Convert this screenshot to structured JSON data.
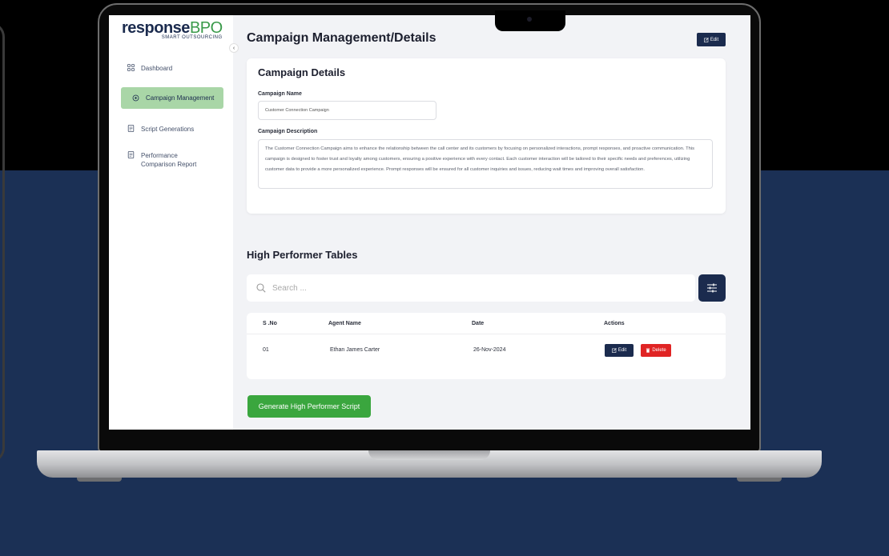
{
  "app": {
    "logo_main": "response",
    "logo_accent": "BPO",
    "logo_sub": "SMART OUTSOURCING"
  },
  "sidebar": {
    "collapse_glyph": "‹",
    "items": [
      {
        "label": "Dashboard",
        "icon": "dashboard-icon",
        "active": false
      },
      {
        "label": "Campaign Management",
        "icon": "campaign-icon",
        "active": true
      },
      {
        "label": "Script Generations",
        "icon": "document-icon",
        "active": false
      },
      {
        "label": "Performance Comparison Report",
        "icon": "report-icon",
        "active": false
      }
    ]
  },
  "header": {
    "title": "Campaign Management/Details",
    "edit_label": "Edit"
  },
  "details": {
    "title": "Campaign Details",
    "name_label": "Campaign Name",
    "name_value": "Customer Connection Campaign",
    "desc_label": "Campaign Description",
    "desc_value": "The Customer Connection Campaign aims to enhance the relationship between the call center and its customers by focusing on personalized interactions, prompt responses, and proactive communication. This campaign is designed to foster trust and loyalty among customers, ensuring a positive experience with every contact. Each customer interaction will be tailored to their specific needs and preferences, utilizing customer data to provide a more personalized experience. Prompt responses will be ensured for all customer inquiries and issues, reducing wait times and improving overall satisfaction."
  },
  "high_performers": {
    "title": "High Performer Tables",
    "search_placeholder": "Search ...",
    "columns": [
      "S .No",
      "Agent Name",
      "Date",
      "Actions"
    ],
    "rows": [
      {
        "sno": "01",
        "agent": "Ethan James Carter",
        "date": "26-Nov-2024"
      }
    ],
    "edit_label": "Edit",
    "delete_label": "Delete",
    "generate_label": "Generate High Performer Script"
  },
  "colors": {
    "brand_navy": "#1b2b4e",
    "brand_green": "#3aa63e",
    "active_nav": "#a9d6a7",
    "danger": "#e02424",
    "page_bg": "#1b3055"
  }
}
